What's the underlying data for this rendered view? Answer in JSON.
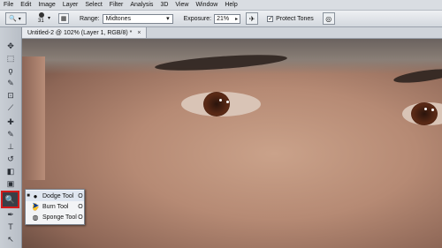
{
  "menubar": {
    "items": [
      "File",
      "Edit",
      "Image",
      "Layer",
      "Select",
      "Filter",
      "Analysis",
      "3D",
      "View",
      "Window",
      "Help"
    ]
  },
  "options": {
    "brush_size": "31",
    "range_label": "Range:",
    "range_value": "Midtones",
    "exposure_label": "Exposure:",
    "exposure_value": "21%",
    "protect_tones_label": "Protect Tones",
    "protect_tones_checked": true
  },
  "document": {
    "tab_title": "Untitled-2 @ 102% (Layer 1, RGB/8) *",
    "close_symbol": "×"
  },
  "toolbox": {
    "tools": [
      {
        "name": "move-tool",
        "glyph": "▸✥"
      },
      {
        "name": "marquee-tool",
        "glyph": "⬚"
      },
      {
        "name": "lasso-tool",
        "glyph": "ϙ"
      },
      {
        "name": "quick-selection-tool",
        "glyph": "✎"
      },
      {
        "name": "crop-tool",
        "glyph": "⊡"
      },
      {
        "name": "eyedropper-tool",
        "glyph": "⟋"
      },
      {
        "name": "healing-brush-tool",
        "glyph": "✚"
      },
      {
        "name": "brush-tool",
        "glyph": "✎"
      },
      {
        "name": "clone-stamp-tool",
        "glyph": "⊥"
      },
      {
        "name": "history-brush-tool",
        "glyph": "↺"
      },
      {
        "name": "eraser-tool",
        "glyph": "◧"
      },
      {
        "name": "gradient-tool",
        "glyph": "▣"
      },
      {
        "name": "dodge-tool",
        "glyph": "🔍"
      },
      {
        "name": "pen-tool",
        "glyph": "✒"
      },
      {
        "name": "type-tool",
        "glyph": "T"
      },
      {
        "name": "path-selection-tool",
        "glyph": "↖"
      }
    ]
  },
  "flyout": {
    "items": [
      {
        "label": "Dodge Tool",
        "key": "O",
        "icon": "dodge-icon",
        "selected": true
      },
      {
        "label": "Burn Tool",
        "key": "O",
        "icon": "burn-icon",
        "selected": false
      },
      {
        "label": "Sponge Tool",
        "key": "O",
        "icon": "sponge-icon",
        "selected": false
      }
    ]
  }
}
